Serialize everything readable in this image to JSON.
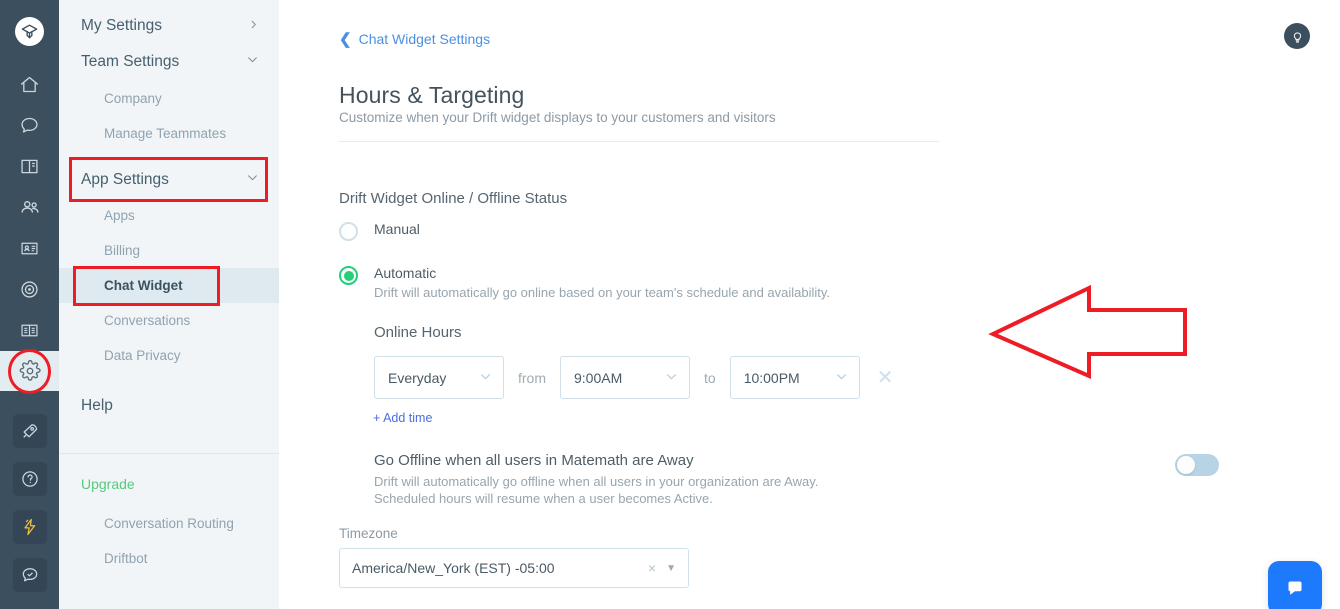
{
  "rail": {
    "logo_icon": "drift-logo-icon",
    "items": [
      {
        "icon": "home-icon",
        "name": "rail-item-home",
        "active": false,
        "boxed": false
      },
      {
        "icon": "chat-bubble-icon",
        "name": "rail-item-conversations",
        "active": false,
        "boxed": false
      },
      {
        "icon": "book-icon",
        "name": "rail-item-playbooks",
        "active": false,
        "boxed": false
      },
      {
        "icon": "people-icon",
        "name": "rail-item-contacts",
        "active": false,
        "boxed": false
      },
      {
        "icon": "contact-card-icon",
        "name": "rail-item-accounts",
        "active": false,
        "boxed": false
      },
      {
        "icon": "target-icon",
        "name": "rail-item-targeting",
        "active": false,
        "boxed": false
      },
      {
        "icon": "open-book-icon",
        "name": "rail-item-reports",
        "active": false,
        "boxed": false
      },
      {
        "icon": "gear-icon",
        "name": "rail-item-settings",
        "active": true,
        "boxed": false
      },
      {
        "icon": "rocket-icon",
        "name": "rail-item-getting-started",
        "active": false,
        "boxed": true
      },
      {
        "icon": "question-mark-icon",
        "name": "rail-item-help",
        "active": false,
        "boxed": true
      },
      {
        "icon": "lightning-bolt-icon",
        "name": "rail-item-upgrade",
        "active": false,
        "boxed": true
      },
      {
        "icon": "chat-check-icon",
        "name": "rail-item-feedback",
        "active": false,
        "boxed": true
      }
    ]
  },
  "sidebar": {
    "groups": [
      {
        "label": "My Settings",
        "type": "top",
        "chevron": "chevron-right"
      },
      {
        "label": "Team Settings",
        "type": "top",
        "chevron": "chevron-down"
      },
      {
        "label": "Company",
        "type": "child"
      },
      {
        "label": "Manage Teammates",
        "type": "child"
      },
      {
        "label": "App Settings",
        "type": "top",
        "chevron": "chevron-down",
        "highlighted": true
      },
      {
        "label": "Apps",
        "type": "child"
      },
      {
        "label": "Billing",
        "type": "child"
      },
      {
        "label": "Chat Widget",
        "type": "child",
        "active": true,
        "highlighted": true
      },
      {
        "label": "Conversations",
        "type": "child"
      },
      {
        "label": "Data Privacy",
        "type": "child"
      },
      {
        "label": "Help",
        "type": "top"
      }
    ],
    "upgrade_label": "Upgrade",
    "upgrade_items": [
      {
        "label": "Conversation Routing"
      },
      {
        "label": "Driftbot"
      }
    ]
  },
  "main": {
    "breadcrumb": "Chat Widget Settings",
    "title": "Hours & Targeting",
    "subtitle": "Customize when your Drift widget displays to your customers and visitors",
    "status_section_label": "Drift Widget Online / Offline Status",
    "options": [
      {
        "label": "Manual",
        "desc": "",
        "selected": false
      },
      {
        "label": "Automatic",
        "desc": "Drift will automatically go online based on your team's schedule and availability.",
        "selected": true
      }
    ],
    "online_hours_label": "Online Hours",
    "schedule": {
      "day_value": "Everyday",
      "from_label": "from",
      "start_value": "9:00AM",
      "to_label": "to",
      "end_value": "10:00PM",
      "remove_icon": "close-icon"
    },
    "add_time_label": "+ Add time",
    "offline": {
      "title": "Go Offline when all users in Matemath are Away",
      "desc_line1": "Drift will automatically go offline when all users in your organization are Away.",
      "desc_line2": "Scheduled hours will resume when a user becomes Active.",
      "enabled": false
    },
    "timezone": {
      "label": "Timezone",
      "value": "America/New_York (EST) -05:00",
      "clear_icon": "close-icon",
      "caret_icon": "caret-down-icon"
    },
    "bulb_icon": "lightbulb-icon",
    "launcher_icon": "chat-launcher-icon"
  },
  "annotations": {
    "accent_color": "#ee1c25",
    "arrow_direction": "left",
    "highlight_boxes": [
      "app-settings",
      "chat-widget"
    ],
    "circle_target": "gear-icon"
  }
}
